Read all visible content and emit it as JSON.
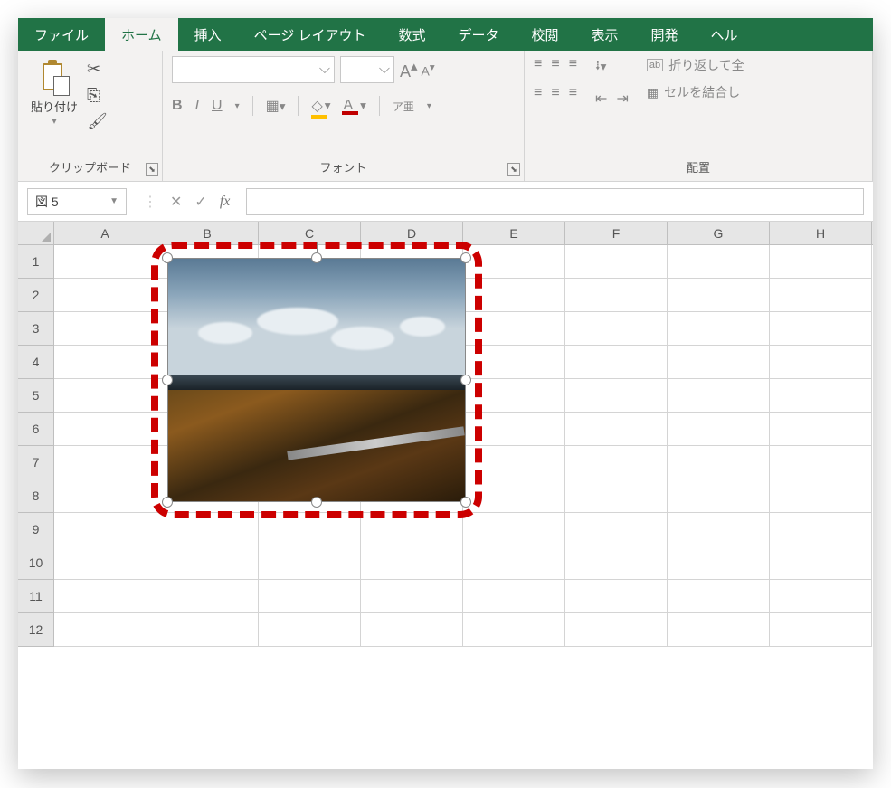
{
  "tabs": {
    "file": "ファイル",
    "home": "ホーム",
    "insert": "挿入",
    "page_layout": "ページ レイアウト",
    "formulas": "数式",
    "data": "データ",
    "review": "校閲",
    "view": "表示",
    "developer": "開発",
    "help": "ヘル"
  },
  "clipboard": {
    "paste_label": "貼り付け",
    "group_label": "クリップボード"
  },
  "font": {
    "group_label": "フォント",
    "increase_a": "A",
    "decrease_a": "A",
    "bold": "B",
    "italic": "I",
    "underline": "U",
    "fill_letter": "A",
    "color_letter": "A",
    "ruby": "ア亜"
  },
  "alignment": {
    "group_label": "配置",
    "wrap_prefix": "ab",
    "wrap_text": "折り返して全",
    "merge_text": "セルを結合し"
  },
  "name_box": "図 5",
  "fx_label": "fx",
  "columns": [
    "A",
    "B",
    "C",
    "D",
    "E",
    "F",
    "G",
    "H"
  ],
  "rows": [
    "1",
    "2",
    "3",
    "4",
    "5",
    "6",
    "7",
    "8",
    "9",
    "10",
    "11",
    "12"
  ],
  "image_object_name": "図 5"
}
